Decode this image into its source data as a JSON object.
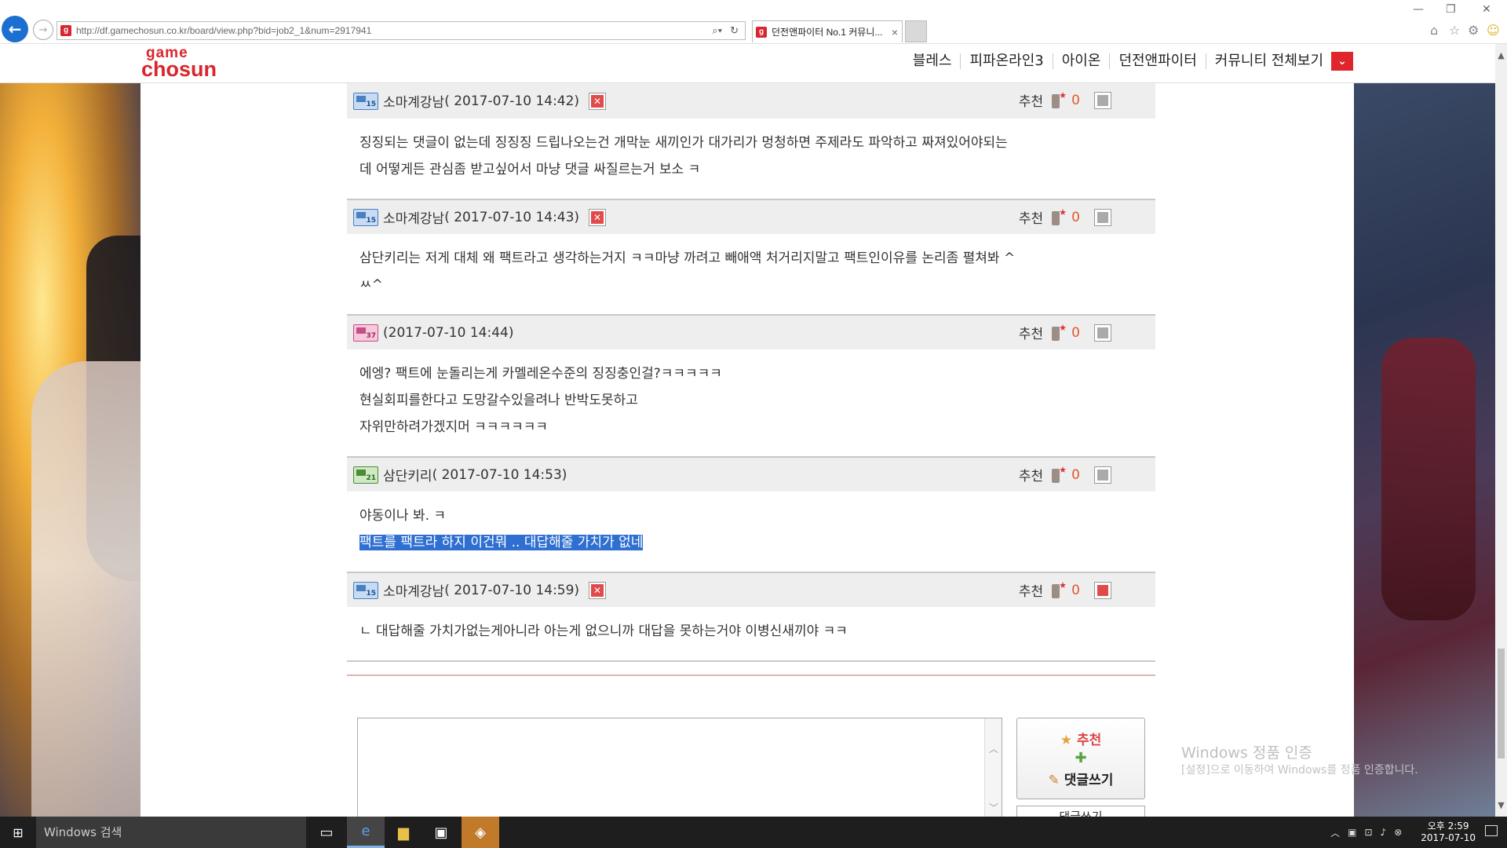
{
  "browser": {
    "url": "http://df.gamechosun.co.kr/board/view.php?bid=job2_1&num=2917941",
    "tab_title": "던전앤파이터 No.1 커뮤니...",
    "tab_close": "×",
    "window_controls": [
      "—",
      "❐",
      "✕"
    ]
  },
  "site": {
    "logo_top": "game",
    "logo_bottom": "chosun",
    "nav": [
      "블레스",
      "피파온라인3",
      "아이온",
      "던전앤파이터",
      "커뮤니티 전체보기"
    ],
    "nav_dropdown": "⌄"
  },
  "comments": [
    {
      "level": "15",
      "author": "소마계강남",
      "time": "( 2017-07-10 14:42)",
      "deletable": true,
      "recommend_label": "추천",
      "recommend_count": "0",
      "body": [
        "징징되는 댓글이 없는데 징징징 드립나오는건 개막눈 새끼인가 대가리가 멍청하면 주제라도 파악하고 짜져있어야되는",
        "데 어떻게든 관심좀 받고싶어서 마냥 댓글 싸질르는거 보소 ㅋ"
      ]
    },
    {
      "level": "15",
      "author": "소마계강남",
      "time": "( 2017-07-10 14:43)",
      "deletable": true,
      "recommend_label": "추천",
      "recommend_count": "0",
      "body": [
        "삼단키리는 저게 대체 왜 팩트라고 생각하는거지 ㅋㅋ마냥 까려고 빼애액 처거리지말고 팩트인이유를 논리좀 펼쳐봐 ^",
        "ㅆ^"
      ]
    },
    {
      "level": "37",
      "author": "",
      "time": "(2017-07-10 14:44)",
      "deletable": false,
      "recommend_label": "추천",
      "recommend_count": "0",
      "body": [
        "에엥? 팩트에 눈돌리는게 카멜레온수준의 징징충인걸?ㅋㅋㅋㅋㅋ",
        "",
        "현실회피를한다고 도망갈수있을려나 반박도못하고",
        "",
        "자위만하려가겠지머 ㅋㅋㅋㅋㅋㅋ"
      ]
    },
    {
      "level": "21",
      "author": "삼단키리",
      "time": "( 2017-07-10 14:53)",
      "deletable": false,
      "recommend_label": "추천",
      "recommend_count": "0",
      "body": [
        "야동이나 봐. ㅋ"
      ],
      "selected_line": "팩트를 팩트라 하지 이건뭐 .. 대답해줄 가치가 없네"
    },
    {
      "level": "15",
      "author": "소마계강남",
      "time": "( 2017-07-10 14:59)",
      "deletable": true,
      "recommend_label": "추천",
      "recommend_count": "0",
      "report_red": true,
      "body": [
        "ㄴ 대답해줄 가치가없는게아니라 아는게 없으니까 대답을 못하는거야 이병신새끼야 ㅋㅋ"
      ]
    }
  ],
  "write_box": {
    "recommend_label": "추천",
    "plus": "✚",
    "write_label": "댓글쓰기",
    "second_button_label": "댓글쓰기"
  },
  "watermark": {
    "title": "Windows 정품 인증",
    "subtitle": "[설정]으로 이동하여 Windows를 정품 인증합니다."
  },
  "taskbar": {
    "search_placeholder": "Windows 검색",
    "time": "오후 2:59",
    "date": "2017-07-10"
  },
  "colors": {
    "brand_red": "#d9262c",
    "selection_blue": "#2e6fd1",
    "recommend_orange": "#e0582a"
  }
}
